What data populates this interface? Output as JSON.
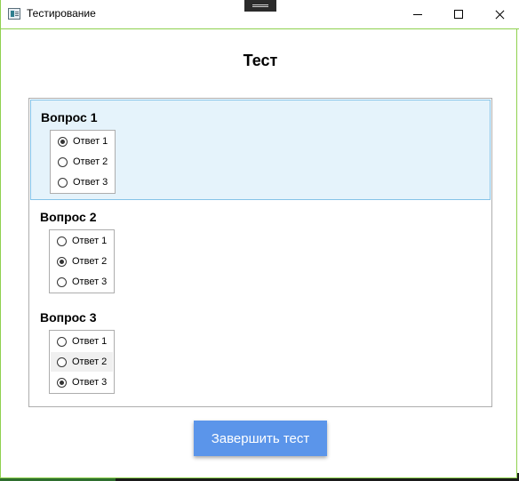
{
  "window": {
    "title": "Тестирование"
  },
  "test": {
    "title": "Тест",
    "finish_label": "Завершить тест"
  },
  "questions": [
    {
      "label": "Вопрос 1",
      "options": [
        "Ответ 1",
        "Ответ 2",
        "Ответ 3"
      ],
      "selected_option": 0,
      "highlighted": true
    },
    {
      "label": "Вопрос 2",
      "options": [
        "Ответ 1",
        "Ответ 2",
        "Ответ 3"
      ],
      "selected_option": 1,
      "highlighted": false
    },
    {
      "label": "Вопрос 3",
      "options": [
        "Ответ 1",
        "Ответ 2",
        "Ответ 3"
      ],
      "selected_option": 2,
      "highlighted": false
    }
  ],
  "colors": {
    "accent_button": "#5b95ea",
    "selection_background": "#e5f3fb",
    "selection_border": "#84c3e8",
    "window_border": "#8fd14f"
  }
}
